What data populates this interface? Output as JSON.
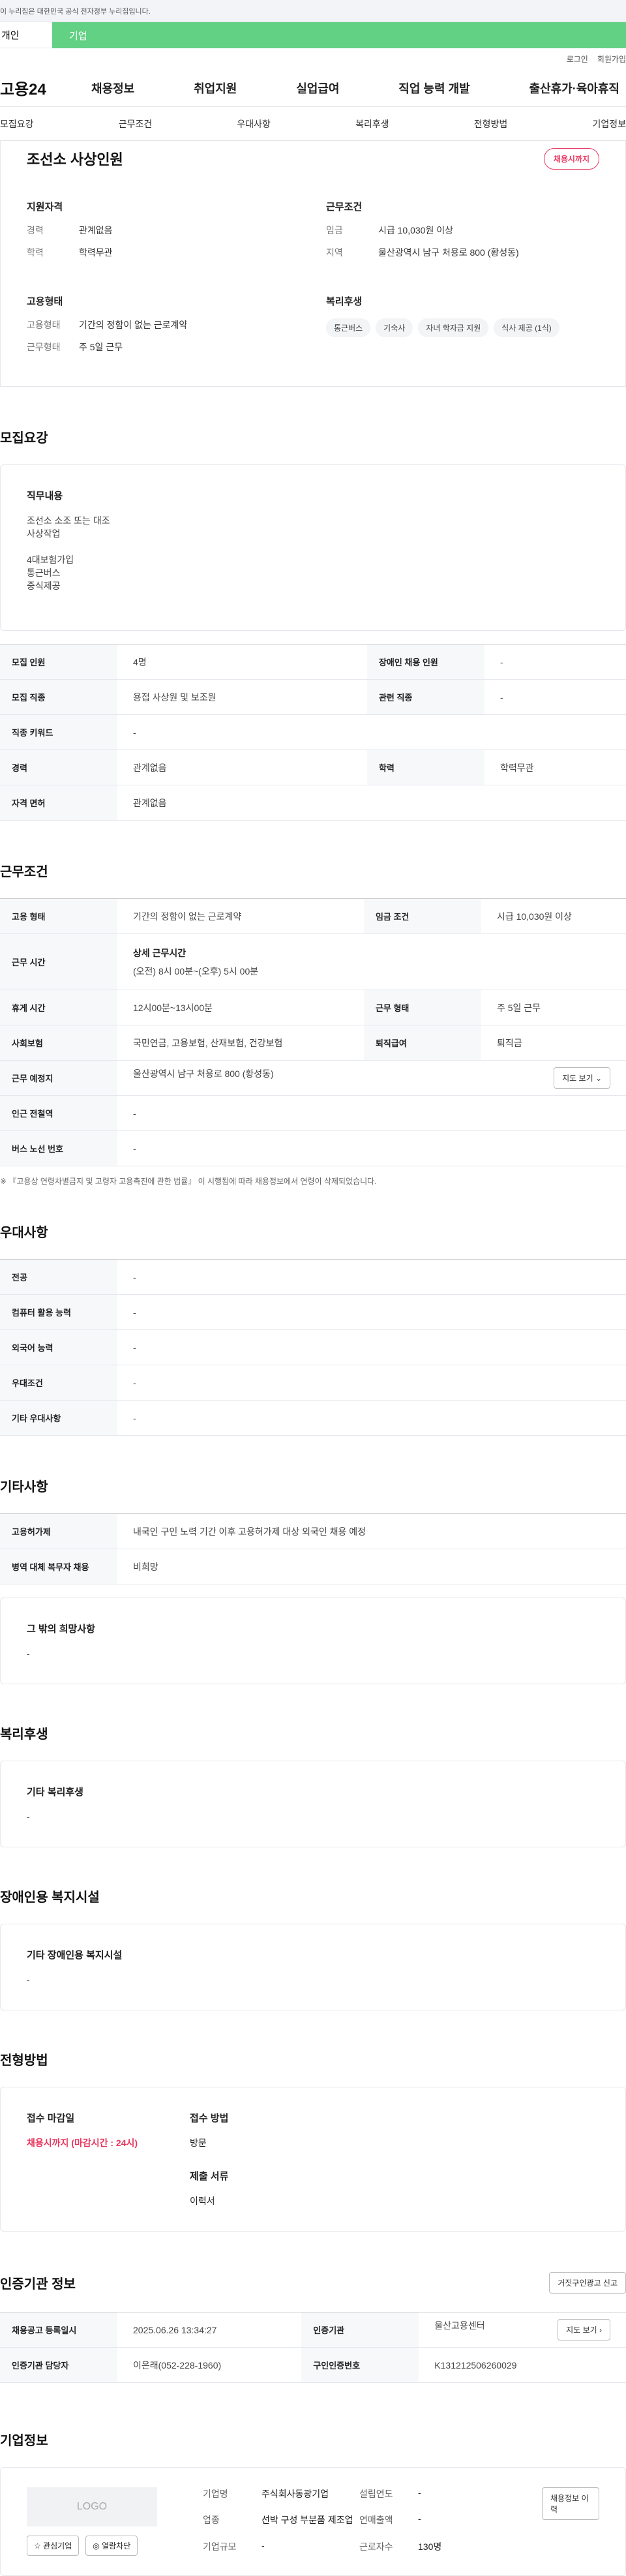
{
  "banner": "이 누리집은 대한민국 공식 전자정부 누리집입니다.",
  "usertabs": {
    "personal": "개인",
    "company": "기업"
  },
  "util": {
    "login": "로그인",
    "signup": "회원가입"
  },
  "logo": "고용24",
  "gnb": [
    "채용정보",
    "취업지원",
    "실업급여",
    "직업 능력 개발",
    "출산휴가·육아휴직"
  ],
  "subnav": [
    "모집요강",
    "근무조건",
    "우대사항",
    "복리후생",
    "전형방법",
    "기업정보"
  ],
  "title": {
    "company": "조선소 사상인원",
    "badge": "채용시까지"
  },
  "summary": {
    "qual_title": "지원자격",
    "qual": [
      {
        "k": "경력",
        "v": "관계없음"
      },
      {
        "k": "학력",
        "v": "학력무관"
      }
    ],
    "work_title": "근무조건",
    "work": [
      {
        "k": "임금",
        "v": "시급 10,030원 이상"
      },
      {
        "k": "지역",
        "v": "울산광역시 남구 처용로 800 (황성동)"
      }
    ],
    "emp_title": "고용형태",
    "emp": [
      {
        "k": "고용형태",
        "v": "기간의 정함이 없는 근로계약"
      },
      {
        "k": "근무형태",
        "v": "주 5일 근무"
      }
    ],
    "welfare_title": "복리후생",
    "welfare_chips": [
      "통근버스",
      "기숙사",
      "자녀 학자금 지원",
      "식사 제공 (1식)"
    ]
  },
  "recruit": {
    "title": "모집요강",
    "duty_title": "직무내용",
    "duty_lines": [
      "조선소 소조 또는 대조",
      "사상작업",
      "",
      "4대보험가입",
      "통근버스",
      "중식제공"
    ],
    "rows": [
      [
        "모집 인원",
        "4명",
        "장애인 채용 인원",
        "-"
      ],
      [
        "모집 직종",
        "용접 사상원 및 보조원",
        "관련 직종",
        "-"
      ],
      [
        "직종 키워드",
        "-"
      ],
      [
        "경력",
        "관계없음",
        "학력",
        "학력무관"
      ],
      [
        "자격 면허",
        "관계없음"
      ]
    ]
  },
  "conditions": {
    "title": "근무조건",
    "emp_type_k": "고용 형태",
    "emp_type_v": "기간의 정함이 없는 근로계약",
    "wage_k": "임금 조건",
    "wage_v": "시급 10,030원 이상",
    "hours_k": "근무 시간",
    "hours_title": "상세 근무시간",
    "hours_v": "(오전) 8시 00분~(오후) 5시 00분",
    "break_k": "휴게 시간",
    "break_v": "12시00분~13시00분",
    "shift_k": "근무 형태",
    "shift_v": "주 5일 근무",
    "ins_k": "사회보험",
    "ins_v": "국민연금, 고용보험, 산재보험, 건강보험",
    "sev_k": "퇴직급여",
    "sev_v": "퇴직금",
    "place_k": "근무 예정지",
    "place_v": "울산광역시 남구 처용로 800 (황성동)",
    "map_btn": "지도 보기 ⌄",
    "subway_k": "인근 전철역",
    "subway_v": "-",
    "bus_k": "버스 노선 번호",
    "bus_v": "-",
    "note": "※ 『고용상 연령차별금지 및 고령자 고용촉진에 관한 법률』 이 시행됨에 따라 채용정보에서 연령이 삭제되었습니다."
  },
  "pref": {
    "title": "우대사항",
    "rows": [
      [
        "전공",
        "-"
      ],
      [
        "컴퓨터 활용 능력",
        "-"
      ],
      [
        "외국어 능력",
        "-"
      ],
      [
        "우대조건",
        "-"
      ],
      [
        "기타 우대사항",
        "-"
      ]
    ]
  },
  "etc": {
    "title": "기타사항",
    "rows": [
      [
        "고용허가제",
        "내국인 구인 노력 기간 이후 고용허가제 대상 외국인 채용 예정"
      ],
      [
        "병역 대체 복무자 채용",
        "비희망"
      ]
    ],
    "box_title": "그 밖의 희망사항",
    "box_v": "-"
  },
  "welfare": {
    "title": "복리후생",
    "box_title": "기타 복리후생",
    "box_v": "-"
  },
  "disabled": {
    "title": "장애인용 복지시설",
    "box_title": "기타 장애인용 복지시설",
    "box_v": "-"
  },
  "process": {
    "title": "전형방법",
    "deadline_title": "접수 마감일",
    "deadline_v": "채용시까지 (마감시간 : 24시)",
    "method_title": "접수 방법",
    "method_v": "방문",
    "docs_title": "제출 서류",
    "docs_v": "이력서"
  },
  "agency": {
    "title": "인증기관 정보",
    "report_btn": "거짓구인광고 신고",
    "reg_k": "채용공고 등록일시",
    "reg_v": "2025.06.26 13:34:27",
    "org_k": "인증기관",
    "org_v": "울산고용센터",
    "map_btn": "지도 보기 ›",
    "mgr_k": "인증기관 담당자",
    "mgr_v": "이은래(052-228-1960)",
    "no_k": "구인인증번호",
    "no_v": "K131212506260029"
  },
  "company": {
    "title": "기업정보",
    "logo": "LOGO",
    "fav_btn": "☆ 관심기업",
    "block_btn": "◎ 열람차단",
    "name_k": "기업명",
    "name_v": "주식회사동광기업",
    "ind_k": "업종",
    "ind_v": "선박 구성 부분품 제조업",
    "size_k": "기업규모",
    "size_v": "-",
    "est_k": "설립연도",
    "est_v": "-",
    "sales_k": "연매출액",
    "sales_v": "-",
    "emp_k": "근로자수",
    "emp_v": "130명",
    "history_btn": "채용정보 이력"
  }
}
